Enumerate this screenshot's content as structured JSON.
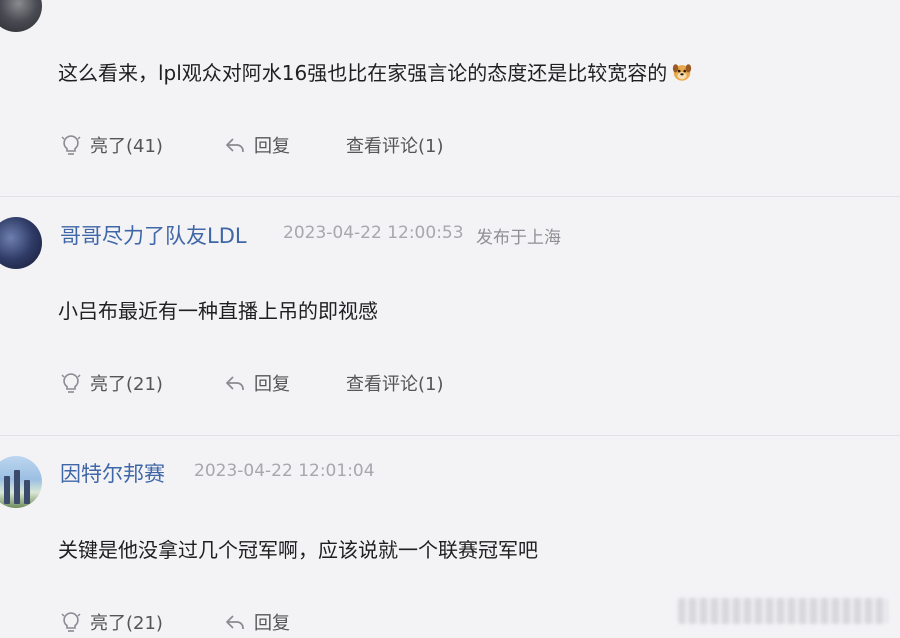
{
  "comments": [
    {
      "username": "",
      "timestamp": "",
      "location": "",
      "content": "这么看来，lpl观众对阿水16强也比在家强言论的态度还是比较宽容的",
      "emoji": "dog-face-emoji",
      "likes_label": "亮了(41)",
      "reply_label": "回复",
      "view_comments_label": "查看评论(1)"
    },
    {
      "username": "哥哥尽力了队友LDL",
      "timestamp": "2023-04-22 12:00:53",
      "location": "发布于上海",
      "content": "小吕布最近有一种直播上吊的即视感",
      "likes_label": "亮了(21)",
      "reply_label": "回复",
      "view_comments_label": "查看评论(1)"
    },
    {
      "username": "因特尔邦赛",
      "timestamp": "2023-04-22 12:01:04",
      "location": "",
      "content": "关键是他没拿过几个冠军啊，应该说就一个联赛冠军吧",
      "likes_label": "亮了(21)",
      "reply_label": "回复"
    }
  ],
  "icons": {
    "like": "lightbulb-icon",
    "reply": "reply-arrow-icon"
  },
  "colors": {
    "background": "#f3f3f6",
    "username": "#3f67a8",
    "meta": "#a7a7ad",
    "text": "#1f1f22"
  }
}
